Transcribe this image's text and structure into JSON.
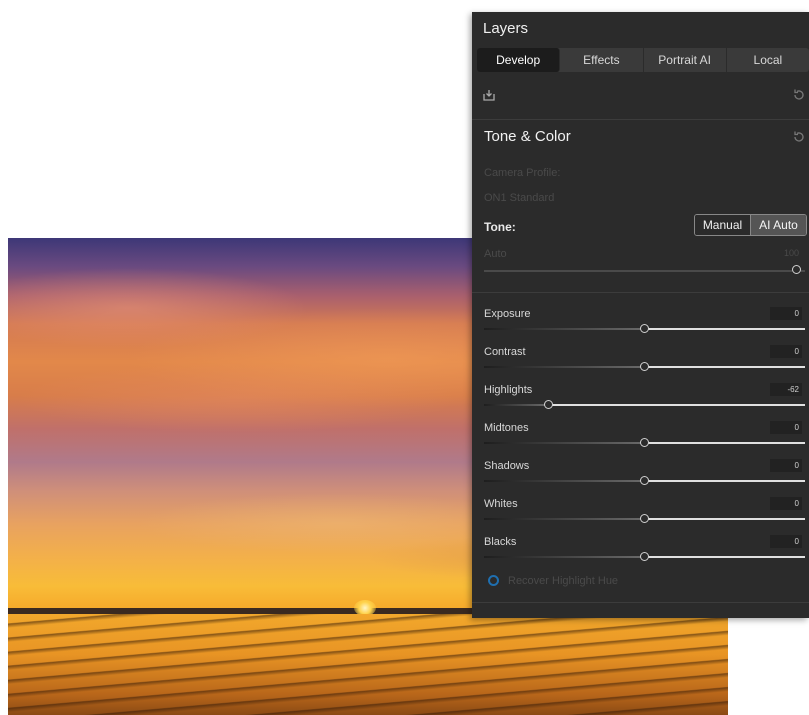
{
  "panel": {
    "title": "Layers",
    "tabs": [
      "Develop",
      "Effects",
      "Portrait AI",
      "Local"
    ],
    "active_tab": "Develop"
  },
  "tone_color": {
    "section_title": "Tone & Color",
    "camera_profile_label": "Camera Profile:",
    "camera_profile_value": "ON1 Standard",
    "tone_label": "Tone:",
    "tone_modes": [
      "Manual",
      "AI Auto"
    ],
    "selected_mode": "AI Auto",
    "auto_label": "Auto",
    "auto_value": "100",
    "sliders": [
      {
        "label": "Exposure",
        "value": "0",
        "fraction": 0.5
      },
      {
        "label": "Contrast",
        "value": "0",
        "fraction": 0.5
      },
      {
        "label": "Highlights",
        "value": "-62",
        "fraction": 0.2
      },
      {
        "label": "Midtones",
        "value": "0",
        "fraction": 0.5
      },
      {
        "label": "Shadows",
        "value": "0",
        "fraction": 0.5
      },
      {
        "label": "Whites",
        "value": "0",
        "fraction": 0.5
      },
      {
        "label": "Blacks",
        "value": "0",
        "fraction": 0.5
      }
    ],
    "recover_label": "Recover Highlight Hue"
  },
  "colors": {
    "panel_bg": "#2b2b2b",
    "accent_blue": "#1f6fb0"
  }
}
